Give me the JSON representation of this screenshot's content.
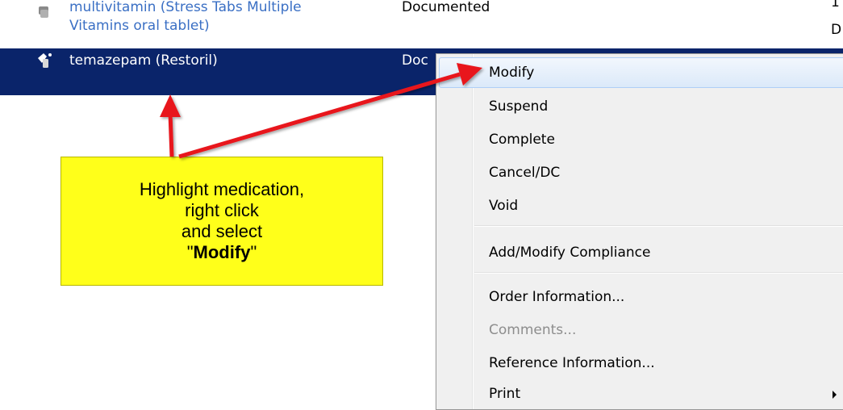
{
  "medications": {
    "previous_row": {
      "name_line1": "multivitamin (Stress Tabs Multiple",
      "name_line2": "Vitamins oral tablet)",
      "status": "Documented",
      "trunc1": "1",
      "trunc2": "D"
    },
    "selected_row": {
      "name": "temazepam (Restoril)",
      "status": "Doc"
    }
  },
  "context_menu": {
    "items": [
      {
        "label": "Modify",
        "highlighted": true
      },
      {
        "label": "Suspend"
      },
      {
        "label": "Complete"
      },
      {
        "label": "Cancel/DC"
      },
      {
        "label": "Void"
      },
      {
        "label": "Add/Modify Compliance"
      },
      {
        "label": "Order Information..."
      },
      {
        "label": "Comments...",
        "disabled": true
      },
      {
        "label": "Reference Information..."
      },
      {
        "label": "Print",
        "has_submenu": true
      }
    ]
  },
  "callout": {
    "line1": "Highlight medication,",
    "line2": "right click",
    "line3": "and select",
    "quote_open": "\"",
    "emphasis": "Modify",
    "quote_close": "\""
  },
  "colors": {
    "selection": "#0a246a",
    "link_text": "#3a6fc4",
    "callout_bg": "#ffff1a",
    "arrow": "#e8141c"
  },
  "icons": {
    "medication": "pill-bottle-icon"
  }
}
